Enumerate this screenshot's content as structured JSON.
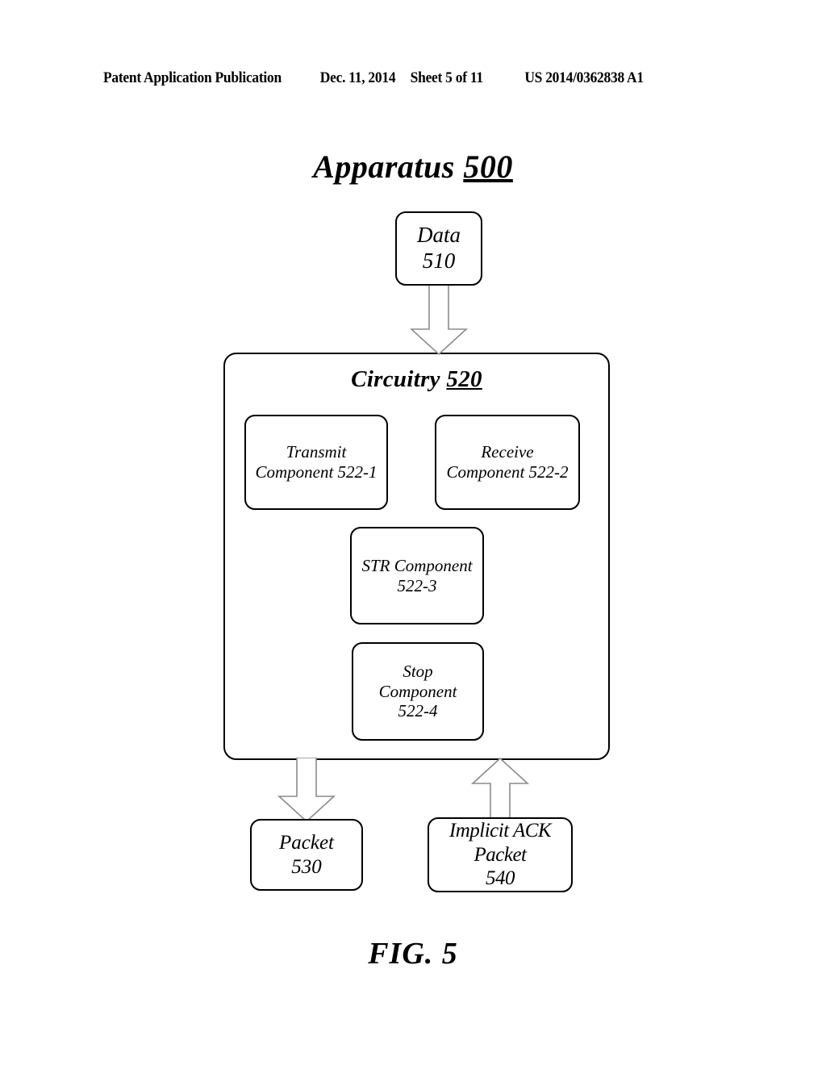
{
  "header": {
    "publication": "Patent Application Publication",
    "date": "Dec. 11, 2014",
    "sheet": "Sheet 5 of 11",
    "document_number": "US 2014/0362838 A1"
  },
  "figure": {
    "title_text": "Apparatus",
    "title_number": "500",
    "caption": "FIG. 5"
  },
  "nodes": {
    "data": {
      "line1": "Data",
      "line2": "510"
    },
    "circuitry": {
      "title_text": "Circuitry",
      "title_number": "520"
    },
    "transmit": {
      "line1": "Transmit",
      "line2": "Component 522-1"
    },
    "receive": {
      "line1": "Receive",
      "line2": "Component 522-2"
    },
    "str": {
      "line1": "STR Component",
      "line2": "522-3"
    },
    "stop": {
      "line1": "Stop",
      "line2": "Component",
      "line3": "522-4"
    },
    "packet": {
      "line1": "Packet",
      "line2": "530"
    },
    "implicit_ack_packet": {
      "line1": "Implicit ACK",
      "line2": "Packet",
      "line3": "540"
    }
  },
  "arrows": [
    {
      "name": "data-to-circuitry",
      "direction": "down"
    },
    {
      "name": "circuitry-to-packet",
      "direction": "down"
    },
    {
      "name": "ack-packet-to-circuitry",
      "direction": "up"
    }
  ],
  "colors": {
    "ink": "#000000",
    "arrow_outline": "#8c8c8c",
    "background": "#ffffff"
  }
}
